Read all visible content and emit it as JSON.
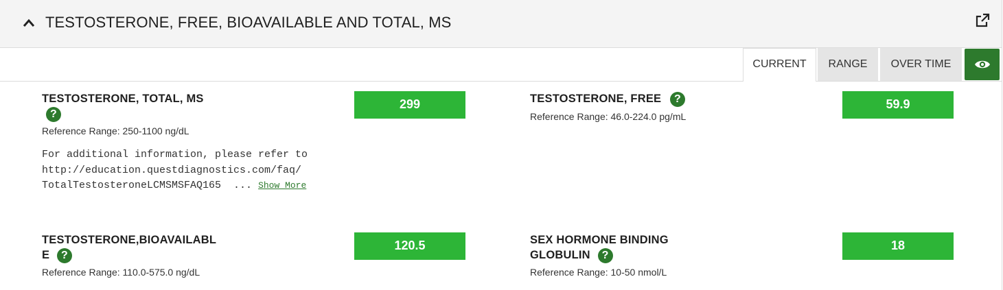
{
  "panel": {
    "title": "TESTOSTERONE, FREE, BIOAVAILABLE AND TOTAL, MS"
  },
  "tabs": [
    {
      "label": "CURRENT",
      "active": true
    },
    {
      "label": "RANGE",
      "active": false
    },
    {
      "label": "OVER TIME",
      "active": false
    }
  ],
  "help_glyph": "?",
  "colors": {
    "accent_green": "#2d7a2d",
    "result_green": "#2db537"
  },
  "results": [
    {
      "name_line1": "TESTOSTERONE, TOTAL, MS",
      "reference": "Reference Range: 250-1100 ng/dL",
      "value": "299",
      "note_line1": "For additional information, please refer to",
      "note_line2": "http://education.questdiagnostics.com/faq/",
      "note_line3": "TotalTestosteroneLCMSMSFAQ165  ... ",
      "show_more": "Show More"
    },
    {
      "name_line1": "TESTOSTERONE, FREE",
      "reference": "Reference Range: 46.0-224.0 pg/mL",
      "value": "59.9"
    },
    {
      "name_line1": "TESTOSTERONE,BIOAVAILABL",
      "name_line2": "E",
      "reference": "Reference Range: 110.0-575.0 ng/dL",
      "value": "120.5"
    },
    {
      "name_line1": "SEX HORMONE BINDING",
      "name_line2": "GLOBULIN",
      "reference": "Reference Range: 10-50 nmol/L",
      "value": "18"
    }
  ]
}
